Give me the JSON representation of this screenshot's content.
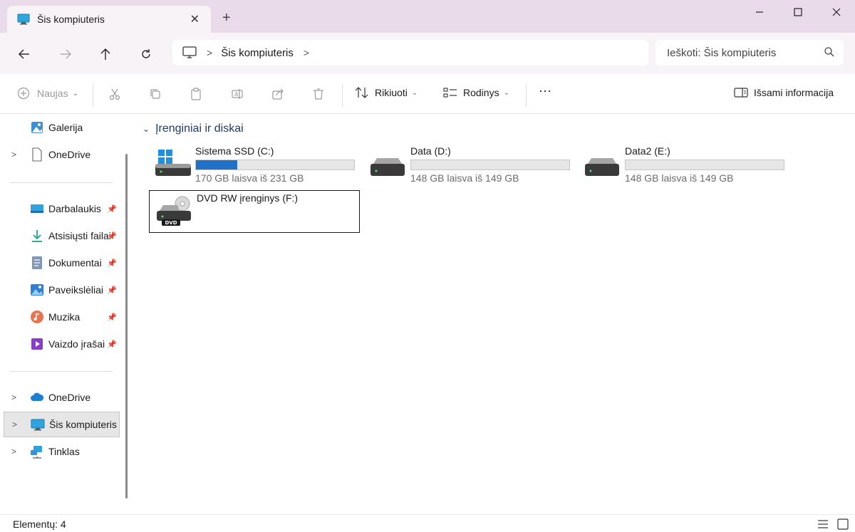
{
  "window": {
    "tab_title": "Šis kompiuteris",
    "new_tab": "+",
    "controls": {
      "minimize": "—",
      "maximize": "☐",
      "close": "✕"
    }
  },
  "nav": {
    "breadcrumb": [
      "Šis kompiuteris"
    ],
    "search_placeholder": "Ieškoti: Šis kompiuteris"
  },
  "toolbar": {
    "new_label": "Naujas",
    "sort_label": "Rikiuoti",
    "view_label": "Rodinys",
    "more_label": "···",
    "details_label": "Išsami informacija"
  },
  "sidebar": {
    "top": [
      {
        "label": "Galerija",
        "icon": "gallery-icon"
      },
      {
        "label": "OneDrive",
        "icon": "document-icon"
      }
    ],
    "quick": [
      {
        "label": "Darbalaukis",
        "icon": "desktop-icon"
      },
      {
        "label": "Atsisiųsti failai",
        "icon": "download-icon"
      },
      {
        "label": "Dokumentai",
        "icon": "documents-icon"
      },
      {
        "label": "Paveikslėliai",
        "icon": "pictures-icon"
      },
      {
        "label": "Muzika",
        "icon": "music-icon"
      },
      {
        "label": "Vaizdo įrašai",
        "icon": "videos-icon"
      }
    ],
    "bottom": [
      {
        "label": "OneDrive",
        "icon": "cloud-icon"
      },
      {
        "label": "Šis kompiuteris",
        "icon": "computer-icon",
        "selected": true
      },
      {
        "label": "Tinklas",
        "icon": "network-icon"
      }
    ]
  },
  "main": {
    "group_title": "Įrenginiai ir diskai",
    "drives": [
      {
        "name": "Sistema SSD (C:)",
        "free": "170 GB laisva iš 231 GB",
        "used_fraction": 0.26
      },
      {
        "name": "Data (D:)",
        "free": "148 GB laisva iš 149 GB",
        "used_fraction": 0.0
      },
      {
        "name": "Data2 (E:)",
        "free": "148 GB laisva iš 149 GB",
        "used_fraction": 0.0
      },
      {
        "name": "DVD RW įrenginys (F:)",
        "badge": "DVD"
      }
    ]
  },
  "status": {
    "count": "Elementų: 4"
  },
  "colors": {
    "accent": "#1f72c8",
    "titlebar": "#e9dbea",
    "selected": "#e6e6e6"
  }
}
